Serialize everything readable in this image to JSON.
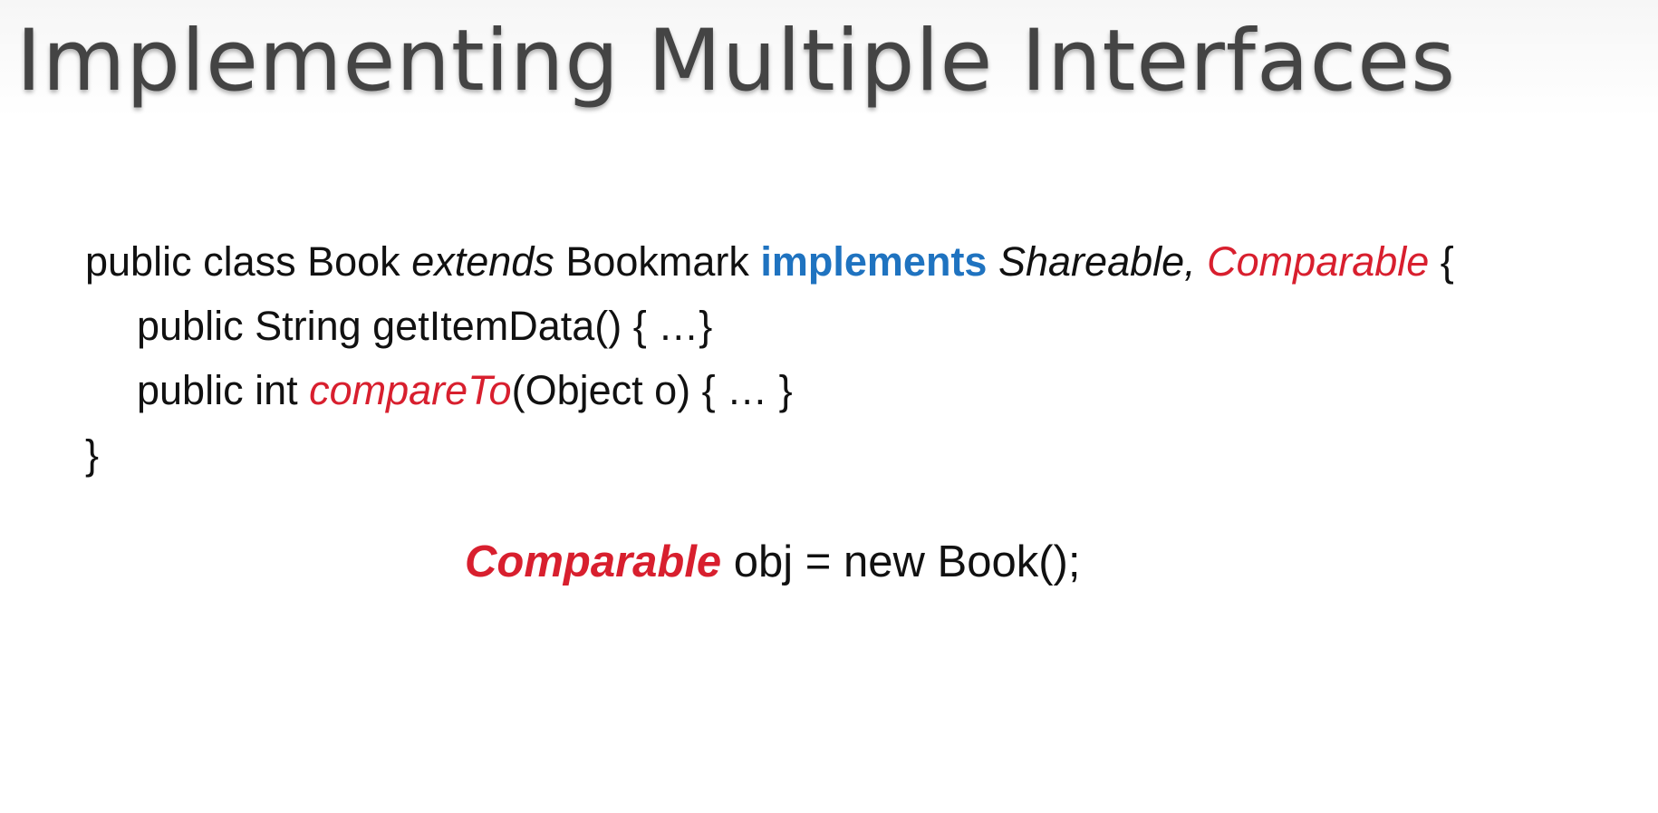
{
  "slide": {
    "title": "Implementing Multiple Interfaces",
    "code": {
      "line1": {
        "t1": "public class Book ",
        "t2": "extends",
        "t3": " Bookmark ",
        "t4": "implements",
        "t5": " ",
        "t6": "Shareable, ",
        "t7": "Comparable",
        "t8": " {"
      },
      "line2": {
        "t1": "public String getItemData() { …}"
      },
      "line3": {
        "t1": "public int ",
        "t2": "compareTo",
        "t3": "(Object  o) { … }"
      },
      "line4": {
        "t1": "}"
      }
    },
    "statement": {
      "t1": "Comparable",
      "t2": " obj = new Book();"
    },
    "colors": {
      "keyword_blue": "#1f73c0",
      "highlight_red": "#d81f2e",
      "title_gray": "#444444"
    }
  }
}
